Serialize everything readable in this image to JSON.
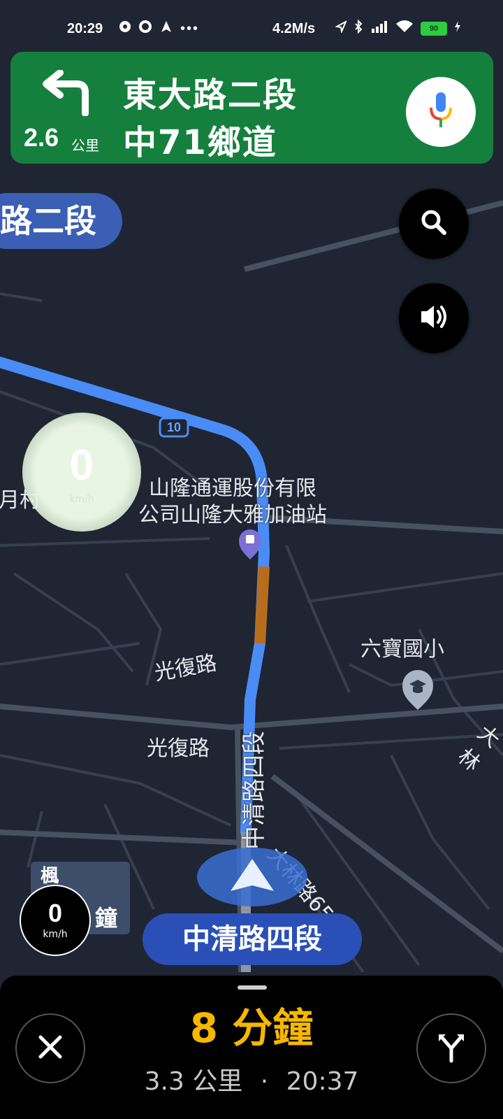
{
  "status_bar": {
    "time": "20:29",
    "icons": [
      "notification-icon",
      "settings-icon",
      "navigation-icon",
      "more-icon"
    ],
    "network_speed": "4.2M/s",
    "right_icons": [
      "location-icon",
      "bluetooth-icon",
      "signal-icon",
      "wifi-icon"
    ],
    "battery": "90"
  },
  "nav_instruction": {
    "turn": "turn-left-icon",
    "distance_value": "2.6",
    "distance_unit": "公里",
    "street_primary": "東大路二段",
    "street_secondary": "中71鄉道"
  },
  "road_chip": {
    "label": "路二段"
  },
  "map": {
    "route_marker": "10",
    "poi_name_line1": "山隆通運股份有限",
    "poi_name_line2": "公司山隆大雅加油站",
    "school": "六寶國小",
    "labels": {
      "guangfu_upper": "光復路",
      "guangfu_lower": "光復路",
      "zhongqing_vertical": "中清路四段",
      "dalin_lane": "大林路65巷",
      "left_edge": "月村",
      "right_edge": "大林"
    }
  },
  "speed": {
    "value": "0",
    "unit": "km/h"
  },
  "sign_board": {
    "char_top": "楓",
    "char_bottom": "鐘"
  },
  "current_road": "中清路四段",
  "bottom_panel": {
    "eta_duration": "8 分鐘",
    "distance": "3.3 公里",
    "separator": "·",
    "arrival_time": "20:37"
  },
  "colors": {
    "nav_card": "#15803d",
    "route": "#4a8cf5",
    "eta": "#f5b800",
    "map_bg": "#1f2533"
  }
}
